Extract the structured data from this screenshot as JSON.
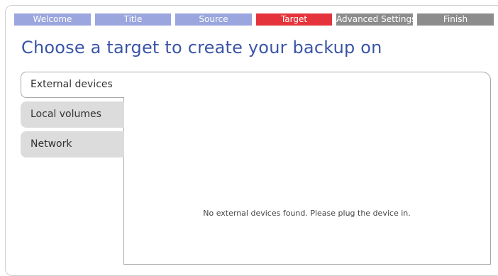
{
  "wizard": {
    "steps": [
      {
        "label": "Welcome",
        "state": "done"
      },
      {
        "label": "Title",
        "state": "done"
      },
      {
        "label": "Source",
        "state": "done"
      },
      {
        "label": "Target",
        "state": "active"
      },
      {
        "label": "Advanced Settings",
        "state": "todo"
      },
      {
        "label": "Finish",
        "state": "todo"
      }
    ],
    "colors": {
      "done": "#9aa6dd",
      "active": "#e5333b",
      "todo": "#8c8c8c",
      "title": "#3a55a6"
    }
  },
  "page": {
    "title": "Choose a target to create your backup on"
  },
  "tabs": [
    {
      "label": "External devices",
      "selected": true
    },
    {
      "label": "Local volumes",
      "selected": false
    },
    {
      "label": "Network",
      "selected": false
    }
  ],
  "content": {
    "empty_message": "No external devices found. Please plug the device in."
  }
}
